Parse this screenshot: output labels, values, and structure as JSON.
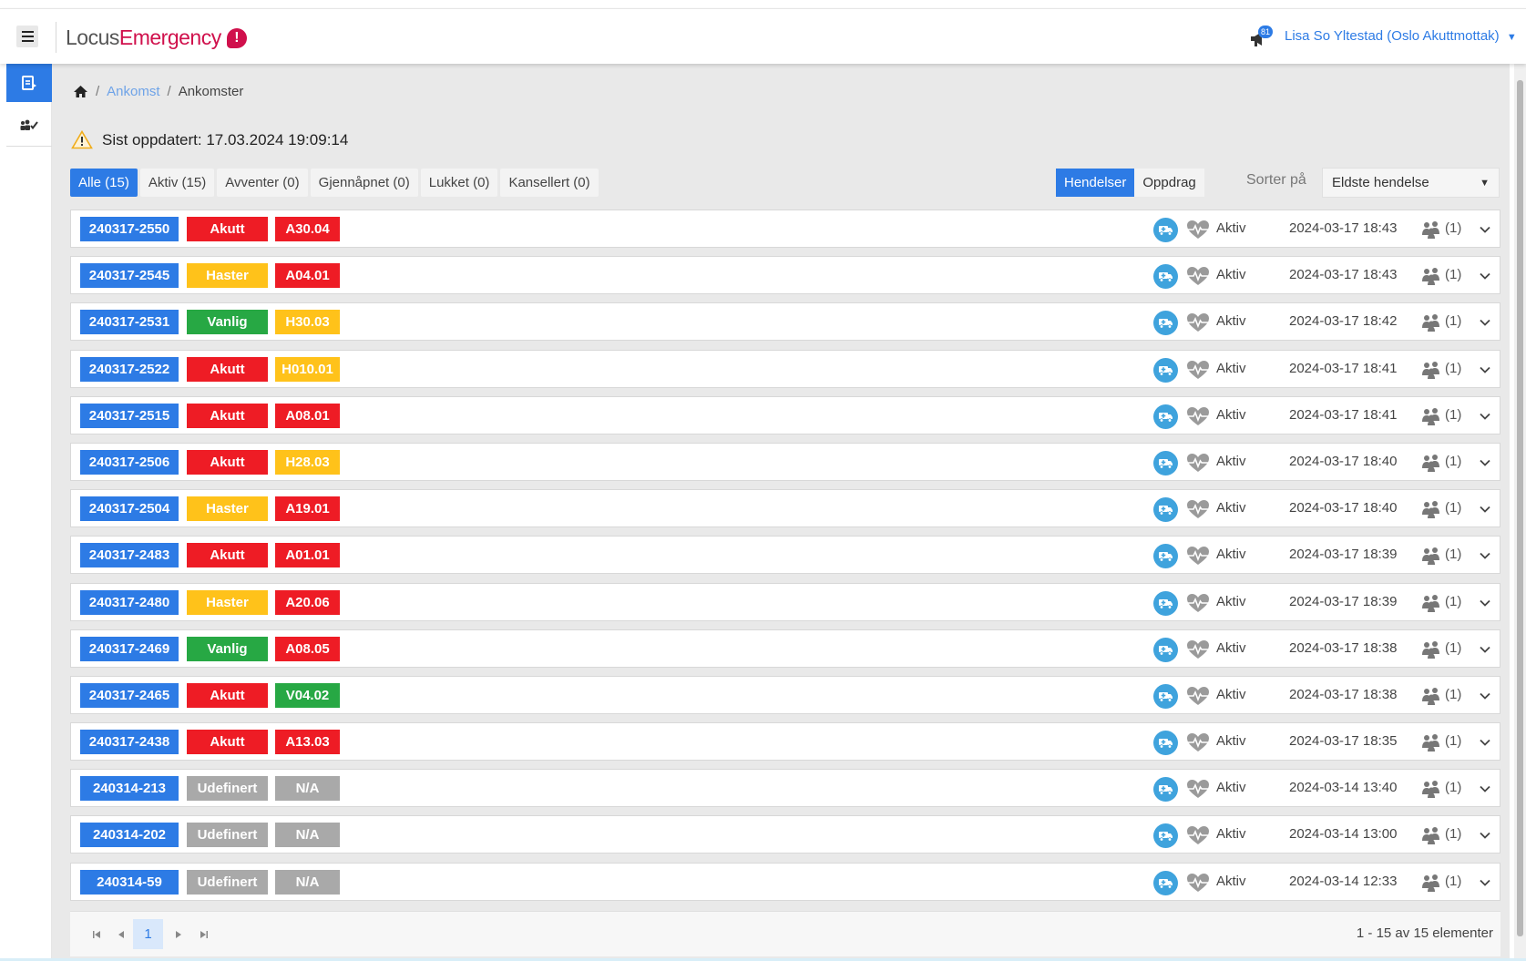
{
  "app": {
    "logo_part1": "Locus",
    "logo_part2": "Emergency",
    "logo_badge": "!",
    "notification_count": "81",
    "user": "Lisa So Yltestad (Oslo Akuttmottak)",
    "user_caret": "▼"
  },
  "breadcrumb": {
    "home_icon": "home-icon",
    "level1": "Ankomst",
    "level2": "Ankomster",
    "separator": "/"
  },
  "status_line": "Sist oppdatert: 17.03.2024 19:09:14",
  "filter_tabs": [
    {
      "label": "Alle (15)",
      "active": true
    },
    {
      "label": "Aktiv (15)",
      "active": false
    },
    {
      "label": "Avventer (0)",
      "active": false
    },
    {
      "label": "Gjennåpnet (0)",
      "active": false
    },
    {
      "label": "Lukket (0)",
      "active": false
    },
    {
      "label": "Kansellert (0)",
      "active": false
    }
  ],
  "view_toggle": {
    "hendelser": "Hendelser",
    "oppdrag": "Oppdrag"
  },
  "sort": {
    "label": "Sorter på",
    "selected": "Eldste hendelse",
    "caret": "▼"
  },
  "colors": {
    "accent": "#2d7be5",
    "red": "#ee1c25",
    "yellow": "#ffc21a",
    "green": "#27a844",
    "gray": "#a9a9a9",
    "brand": "#d0104c"
  },
  "rows": [
    {
      "id": "240317-2550",
      "priority": "Akutt",
      "priority_color": "red",
      "code": "A30.04",
      "code_color": "red",
      "status": "Aktiv",
      "time": "2024-03-17 18:43",
      "count": "(1)"
    },
    {
      "id": "240317-2545",
      "priority": "Haster",
      "priority_color": "yellow",
      "code": "A04.01",
      "code_color": "red",
      "status": "Aktiv",
      "time": "2024-03-17 18:43",
      "count": "(1)"
    },
    {
      "id": "240317-2531",
      "priority": "Vanlig",
      "priority_color": "green",
      "code": "H30.03",
      "code_color": "yellow",
      "status": "Aktiv",
      "time": "2024-03-17 18:42",
      "count": "(1)"
    },
    {
      "id": "240317-2522",
      "priority": "Akutt",
      "priority_color": "red",
      "code": "H010.01",
      "code_color": "yellow",
      "status": "Aktiv",
      "time": "2024-03-17 18:41",
      "count": "(1)"
    },
    {
      "id": "240317-2515",
      "priority": "Akutt",
      "priority_color": "red",
      "code": "A08.01",
      "code_color": "red",
      "status": "Aktiv",
      "time": "2024-03-17 18:41",
      "count": "(1)"
    },
    {
      "id": "240317-2506",
      "priority": "Akutt",
      "priority_color": "red",
      "code": "H28.03",
      "code_color": "yellow",
      "status": "Aktiv",
      "time": "2024-03-17 18:40",
      "count": "(1)"
    },
    {
      "id": "240317-2504",
      "priority": "Haster",
      "priority_color": "yellow",
      "code": "A19.01",
      "code_color": "red",
      "status": "Aktiv",
      "time": "2024-03-17 18:40",
      "count": "(1)"
    },
    {
      "id": "240317-2483",
      "priority": "Akutt",
      "priority_color": "red",
      "code": "A01.01",
      "code_color": "red",
      "status": "Aktiv",
      "time": "2024-03-17 18:39",
      "count": "(1)"
    },
    {
      "id": "240317-2480",
      "priority": "Haster",
      "priority_color": "yellow",
      "code": "A20.06",
      "code_color": "red",
      "status": "Aktiv",
      "time": "2024-03-17 18:39",
      "count": "(1)"
    },
    {
      "id": "240317-2469",
      "priority": "Vanlig",
      "priority_color": "green",
      "code": "A08.05",
      "code_color": "red",
      "status": "Aktiv",
      "time": "2024-03-17 18:38",
      "count": "(1)"
    },
    {
      "id": "240317-2465",
      "priority": "Akutt",
      "priority_color": "red",
      "code": "V04.02",
      "code_color": "green",
      "status": "Aktiv",
      "time": "2024-03-17 18:38",
      "count": "(1)"
    },
    {
      "id": "240317-2438",
      "priority": "Akutt",
      "priority_color": "red",
      "code": "A13.03",
      "code_color": "red",
      "status": "Aktiv",
      "time": "2024-03-17 18:35",
      "count": "(1)"
    },
    {
      "id": "240314-213",
      "priority": "Udefinert",
      "priority_color": "gray",
      "code": "N/A",
      "code_color": "gray",
      "status": "Aktiv",
      "time": "2024-03-14 13:40",
      "count": "(1)"
    },
    {
      "id": "240314-202",
      "priority": "Udefinert",
      "priority_color": "gray",
      "code": "N/A",
      "code_color": "gray",
      "status": "Aktiv",
      "time": "2024-03-14 13:00",
      "count": "(1)"
    },
    {
      "id": "240314-59",
      "priority": "Udefinert",
      "priority_color": "gray",
      "code": "N/A",
      "code_color": "gray",
      "status": "Aktiv",
      "time": "2024-03-14 12:33",
      "count": "(1)"
    }
  ],
  "pager": {
    "first": "⏮",
    "prev": "◀",
    "current": "1",
    "next": "▶",
    "last": "⏭",
    "info": "1 - 15 av 15 elementer"
  }
}
